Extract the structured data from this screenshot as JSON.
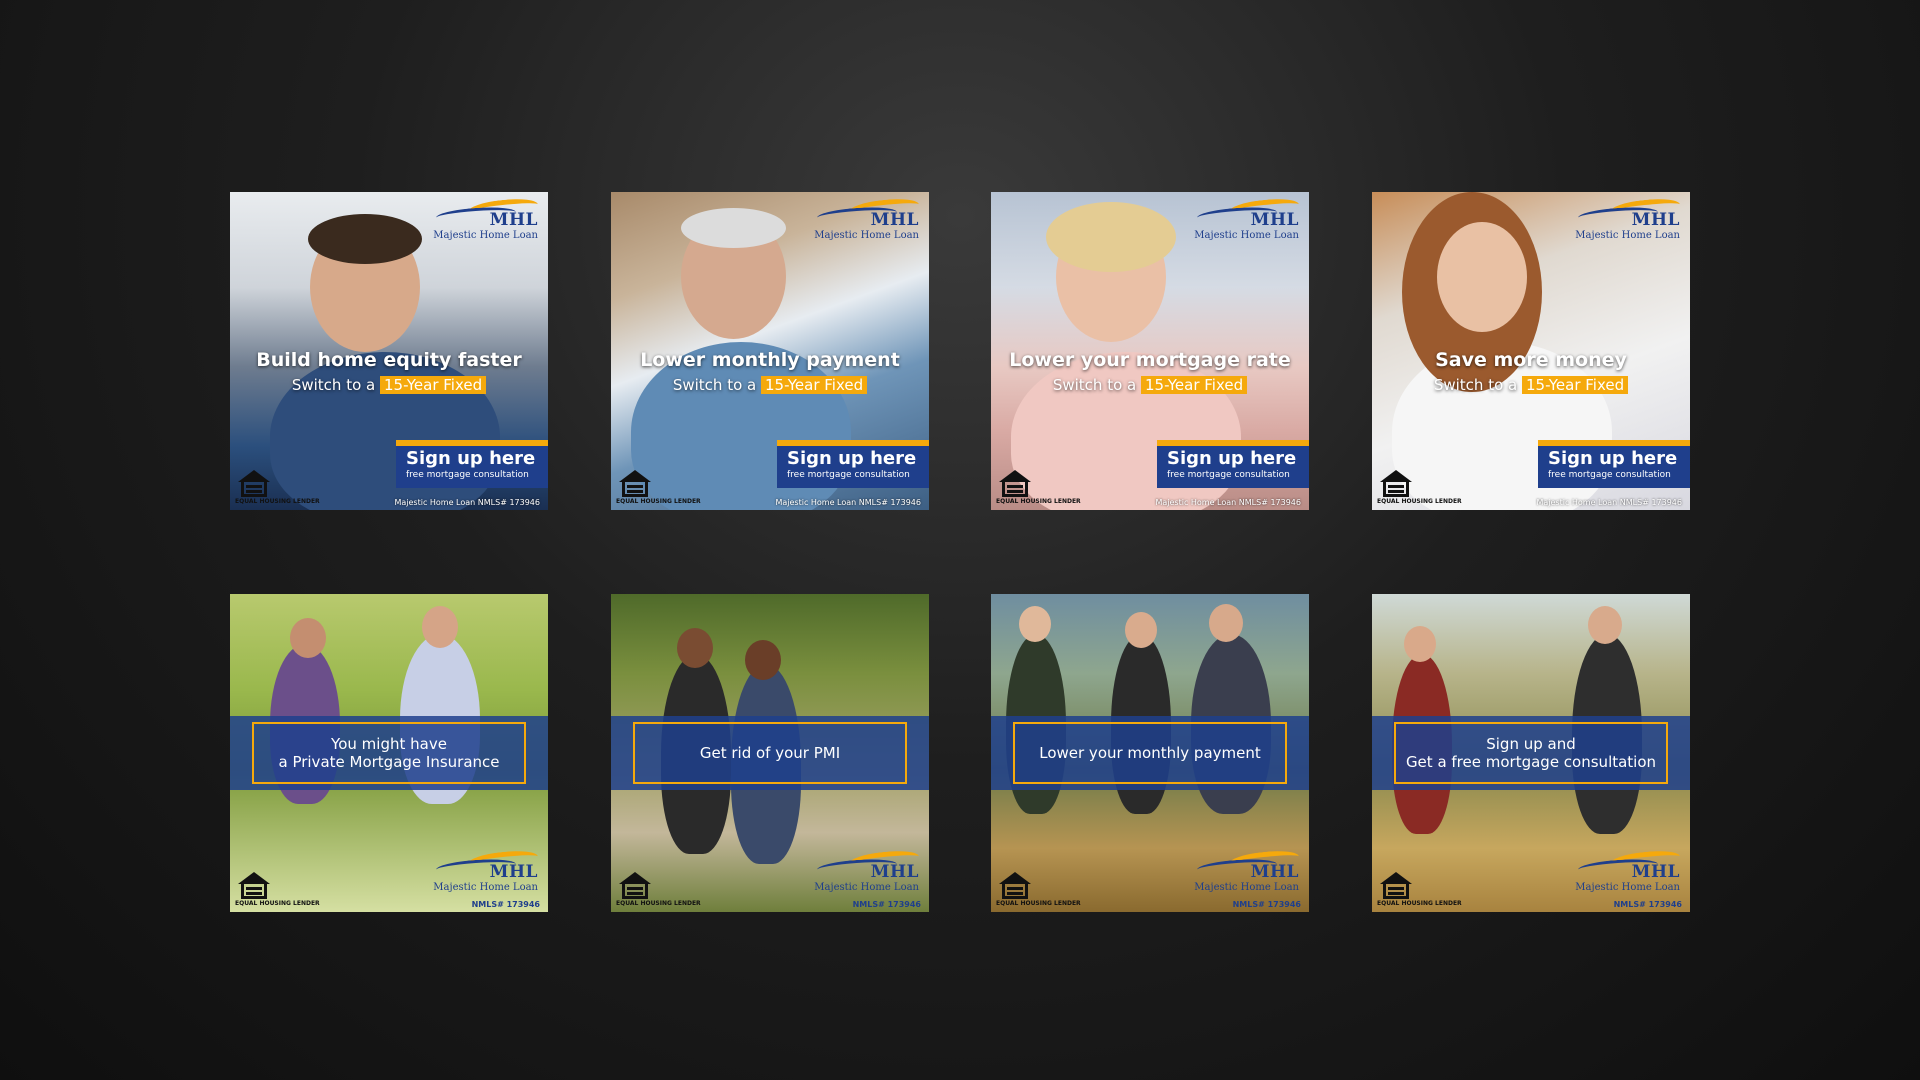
{
  "brand": {
    "logo_mark": "MHL",
    "logo_name": "Majestic Home Loan",
    "colors": {
      "navy": "#1f3f8c",
      "gold": "#f5a90c"
    }
  },
  "ehl": {
    "label": "EQUAL HOUSING LENDER",
    "icon": "equal-housing-icon"
  },
  "top_row": [
    {
      "headline": "Build home equity faster",
      "sub_prefix": "Switch to a",
      "sub_highlight": "15-Year Fixed",
      "cta_title": "Sign up here",
      "cta_sub": "free mortgage consultation",
      "nmls": "Majestic Home Loan NMLS# 173946"
    },
    {
      "headline": "Lower monthly payment",
      "sub_prefix": "Switch to a",
      "sub_highlight": "15-Year Fixed",
      "cta_title": "Sign up here",
      "cta_sub": "free mortgage consultation",
      "nmls": "Majestic Home Loan NMLS# 173946"
    },
    {
      "headline": "Lower your mortgage rate",
      "sub_prefix": "Switch to a",
      "sub_highlight": "15-Year Fixed",
      "cta_title": "Sign up here",
      "cta_sub": "free mortgage consultation",
      "nmls": "Majestic Home Loan NMLS# 173946"
    },
    {
      "headline": "Save more money",
      "sub_prefix": "Switch to a",
      "sub_highlight": "15-Year Fixed",
      "cta_title": "Sign up here",
      "cta_sub": "free mortgage consultation",
      "nmls": "Majestic Home Loan NMLS# 173946"
    }
  ],
  "bottom_row": [
    {
      "line1": "You might have",
      "line2": "a Private Mortgage Insurance",
      "nmls": "NMLS# 173946"
    },
    {
      "line1": "Get rid of your PMI",
      "line2": "",
      "nmls": "NMLS# 173946"
    },
    {
      "line1": "Lower your monthly payment",
      "line2": "",
      "nmls": "NMLS# 173946"
    },
    {
      "line1": "Sign up and",
      "line2": "Get a free mortgage consultation",
      "nmls": "NMLS# 173946"
    }
  ]
}
